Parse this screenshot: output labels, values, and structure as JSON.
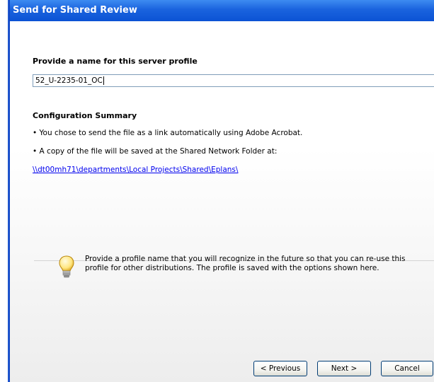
{
  "window": {
    "title": "Send for Shared Review"
  },
  "profile": {
    "label": "Provide a name for this server profile",
    "value": "52_U-2235-01_OC"
  },
  "summary": {
    "heading": "Configuration Summary",
    "line1": "• You chose to send the file as a link automatically using Adobe Acrobat.",
    "line2": "• A copy of the file will be saved at the Shared Network Folder at:",
    "path": "\\\\dt00mh71\\departments\\Local Projects\\Shared\\Eplans\\"
  },
  "tip": {
    "text": "Provide a profile name that you will recognize in the future so that you can re-use this profile for other distributions. The profile is saved with the options shown here."
  },
  "buttons": {
    "previous": "< Previous",
    "next": "Next >",
    "cancel": "Cancel"
  }
}
